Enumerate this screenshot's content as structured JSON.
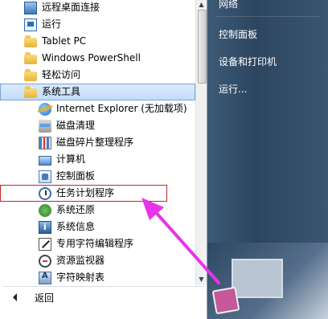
{
  "start_menu": {
    "programs": [
      {
        "label": "远程桌面连接",
        "icon": "remote-desktop-icon"
      },
      {
        "label": "运行",
        "icon": "run-icon"
      },
      {
        "label": "Tablet PC",
        "icon": "folder-icon"
      },
      {
        "label": "Windows PowerShell",
        "icon": "folder-icon"
      },
      {
        "label": "轻松访问",
        "icon": "folder-icon"
      },
      {
        "label": "系统工具",
        "icon": "folder-icon"
      },
      {
        "label": "Internet Explorer (无加载项)",
        "icon": "internet-explorer-icon"
      },
      {
        "label": "磁盘清理",
        "icon": "disk-cleanup-icon"
      },
      {
        "label": "磁盘碎片整理程序",
        "icon": "defrag-icon"
      },
      {
        "label": "计算机",
        "icon": "computer-icon"
      },
      {
        "label": "控制面板",
        "icon": "control-panel-icon"
      },
      {
        "label": "任务计划程序",
        "icon": "clock-icon"
      },
      {
        "label": "系统还原",
        "icon": "system-restore-icon"
      },
      {
        "label": "系统信息",
        "icon": "system-info-icon"
      },
      {
        "label": "专用字符编辑程序",
        "icon": "char-editor-icon"
      },
      {
        "label": "资源监视器",
        "icon": "resource-monitor-icon"
      },
      {
        "label": "字符映射表",
        "icon": "char-map-icon"
      }
    ],
    "back_label": "返回",
    "right_pane": [
      "网络",
      "控制面板",
      "设备和打印机",
      "运行..."
    ]
  },
  "colors": {
    "highlight_box": "#c0272d",
    "annotation_arrow": "#e834e8",
    "selected_bg": "#c1dcfa"
  }
}
